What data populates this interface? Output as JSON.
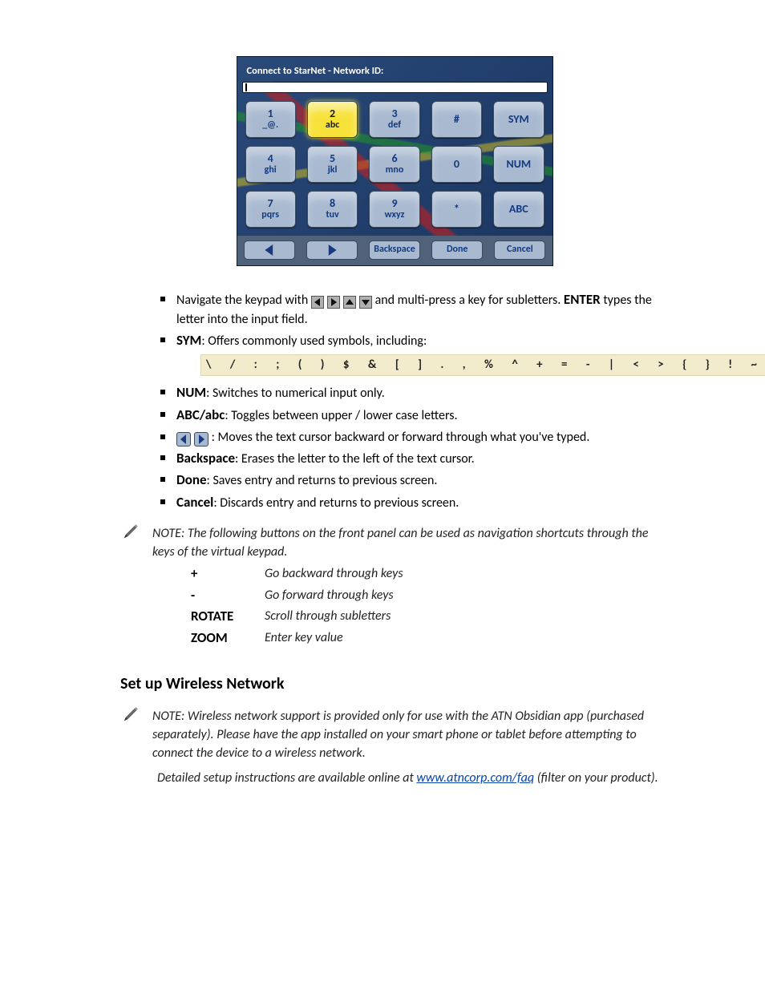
{
  "keypad": {
    "title": "Connect to StarNet - Network ID:",
    "input_value": "",
    "keys": [
      {
        "top": "1",
        "bottom": "_@."
      },
      {
        "top": "2",
        "bottom": "abc",
        "active": true
      },
      {
        "top": "3",
        "bottom": "def"
      },
      {
        "single": "#"
      },
      {
        "single": "SYM"
      },
      {
        "top": "4",
        "bottom": "ghi"
      },
      {
        "top": "5",
        "bottom": "jkl"
      },
      {
        "top": "6",
        "bottom": "mno"
      },
      {
        "single": "0"
      },
      {
        "single": "NUM"
      },
      {
        "top": "7",
        "bottom": "pqrs"
      },
      {
        "top": "8",
        "bottom": "tuv"
      },
      {
        "top": "9",
        "bottom": "wxyz"
      },
      {
        "single": "*"
      },
      {
        "single": "ABC"
      }
    ],
    "bottom": {
      "left_spacer": "",
      "backspace": "Backspace",
      "done": "Done",
      "cancel": "Cancel"
    }
  },
  "bullets": {
    "arrows": {
      "pre": "Navigate the keypad with ",
      "post1": " and multi-press a key for subletters. ",
      "enter": "ENTER",
      "post2": " types the letter into the input field."
    },
    "sym": {
      "label": "SYM",
      "desc": ": Offers commonly used symbols, including:",
      "symbols": "\\ / : ; ( ) $ & [ ] . , % ^ + = - | < > { } ! ~"
    },
    "num": {
      "label": "NUM",
      "desc": ": Switches to numerical input only."
    },
    "abc": {
      "label": "ABC/abc",
      "desc": ": Toggles between upper / lower case letters."
    },
    "lr": {
      "desc": ": Moves the text cursor backward or forward through what you've typed."
    },
    "backspace": {
      "label": "Backspace",
      "desc": ": Erases the letter to the left of the text cursor."
    },
    "done": {
      "label": "Done",
      "desc": ": Saves entry and returns to previous screen."
    },
    "cancel": {
      "label": "Cancel",
      "desc": ": Discards entry and returns to previous screen."
    }
  },
  "note1": {
    "lead": "NOTE: The following buttons on the front panel can be used as navigation shortcuts through the keys of the virtual keypad.",
    "rows": [
      {
        "k": "+",
        "v": "Go backward through keys"
      },
      {
        "k": "-",
        "v": "Go forward through keys"
      },
      {
        "k": "ROTATE",
        "v": "Scroll through subletters"
      },
      {
        "k": "ZOOM",
        "v": "Enter key value"
      }
    ]
  },
  "section_title": "Set up Wireless Network",
  "note2": {
    "p1": "NOTE: Wireless network support is provided only for use with the ATN Obsidian app (purchased separately). Please have the app installed on your smart phone or tablet before attempting to connect the device to a wireless network.",
    "p2_pre": "Detailed setup instructions are available online at ",
    "link_text": "www.atncorp.com/faq",
    "p2_post": " (filter on your product)."
  }
}
